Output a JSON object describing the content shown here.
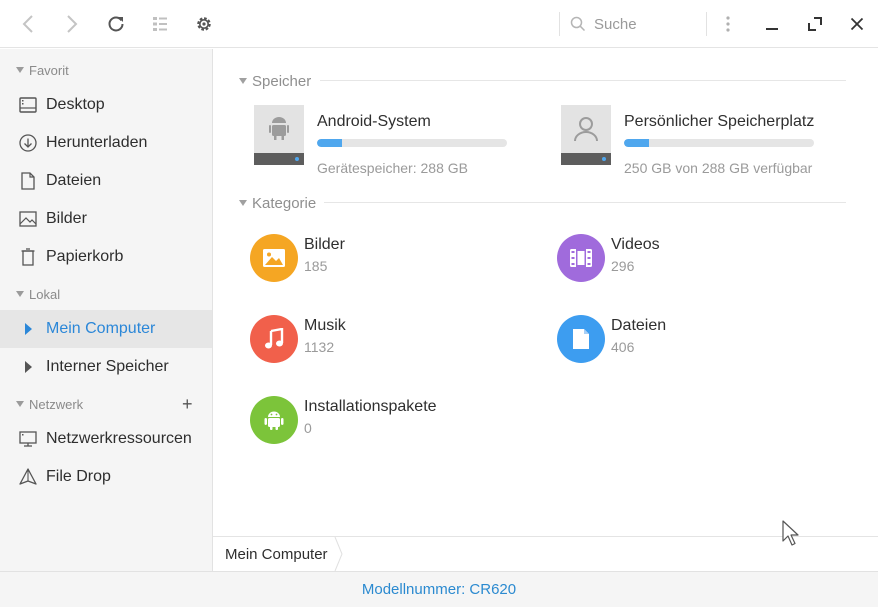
{
  "toolbar": {
    "search_placeholder": "Suche"
  },
  "sidebar": {
    "sections": [
      {
        "label": "Favorit"
      },
      {
        "label": "Lokal"
      },
      {
        "label": "Netzwerk"
      }
    ],
    "favorites": [
      {
        "label": "Desktop",
        "icon": "desktop-icon"
      },
      {
        "label": "Herunterladen",
        "icon": "download-icon"
      },
      {
        "label": "Dateien",
        "icon": "file-icon"
      },
      {
        "label": "Bilder",
        "icon": "image-icon"
      },
      {
        "label": "Papierkorb",
        "icon": "trash-icon"
      }
    ],
    "local": [
      {
        "label": "Mein Computer",
        "icon": "arrow-right-icon",
        "active": true
      },
      {
        "label": "Interner Speicher",
        "icon": "arrow-right-icon"
      }
    ],
    "network": [
      {
        "label": "Netzwerkressourcen",
        "icon": "network-monitor-icon"
      },
      {
        "label": "File Drop",
        "icon": "paper-plane-icon"
      }
    ]
  },
  "main": {
    "storage_title": "Speicher",
    "drives": [
      {
        "name": "Android-System",
        "subtitle": "Gerätespeicher: 288 GB",
        "usage_fraction": 0.13,
        "icon": "android-drive-icon"
      },
      {
        "name": "Persönlicher Speicherplatz",
        "subtitle": "250 GB von 288 GB verfügbar",
        "usage_fraction": 0.13,
        "icon": "user-drive-icon"
      }
    ],
    "category_title": "Kategorie",
    "categories": [
      {
        "name": "Bilder",
        "count": "185",
        "color": "#f5a623",
        "icon": "image-icon"
      },
      {
        "name": "Videos",
        "count": "296",
        "color": "#a06bdc",
        "icon": "film-icon"
      },
      {
        "name": "Musik",
        "count": "1132",
        "color": "#f1604b",
        "icon": "music-note-icon"
      },
      {
        "name": "Dateien",
        "count": "406",
        "color": "#3d9df0",
        "icon": "document-icon"
      },
      {
        "name": "Installationspakete",
        "count": "0",
        "color": "#7cc43a",
        "icon": "android-icon"
      }
    ]
  },
  "pathbar": {
    "crumb": "Mein Computer"
  },
  "status": {
    "text": "Modellnummer: CR620"
  },
  "colors": {
    "accent": "#2b87d8",
    "progress": "#4fa7ee"
  }
}
